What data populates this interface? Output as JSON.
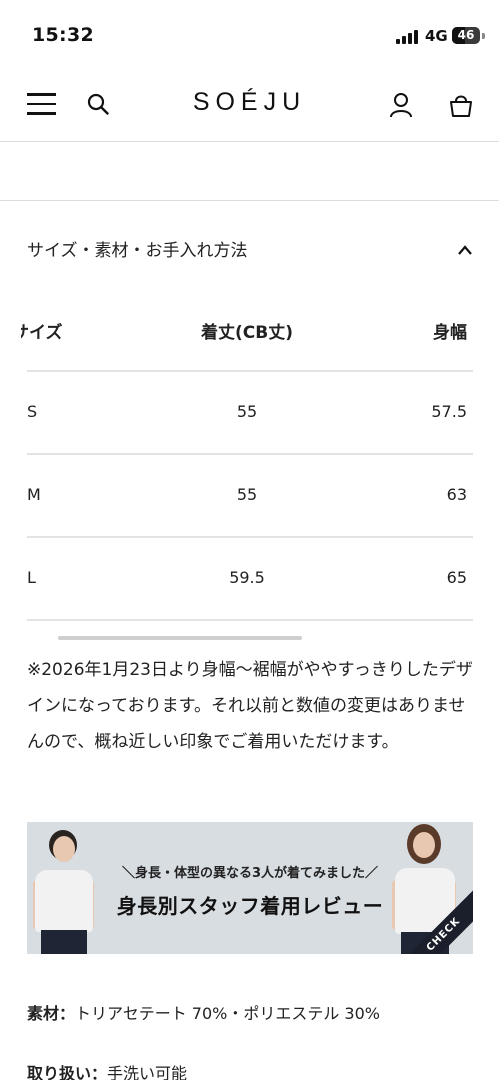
{
  "status_bar": {
    "time": "15:32",
    "network": "4G",
    "battery": "46",
    "battery_level": 0.46
  },
  "header": {
    "logo": "SOÉJU"
  },
  "accordion": {
    "title": "サイズ・素材・お手入れ方法"
  },
  "size_table": {
    "headers": [
      "サイズ",
      "着丈(CB丈)",
      "身幅"
    ],
    "rows": [
      [
        "S",
        "55",
        "57.5"
      ],
      [
        "M",
        "55",
        "63"
      ],
      [
        "L",
        "59.5",
        "65"
      ]
    ]
  },
  "note": "※2026年1月23日より身幅〜裾幅がややすっきりしたデザインになっております。それ以前と数値の変更はありませんので、概ね近しい印象でご着用いただけます。",
  "banner": {
    "subtitle": "＼身長・体型の異なる3人が着てみました／",
    "title": "身長別スタッフ着用レビュー",
    "badge": "CHECK"
  },
  "material": {
    "label": "素材：",
    "value": "トリアセテート 70%・ポリエステル 30%"
  },
  "care": {
    "label": "取り扱い：",
    "value": "手洗い可能"
  }
}
